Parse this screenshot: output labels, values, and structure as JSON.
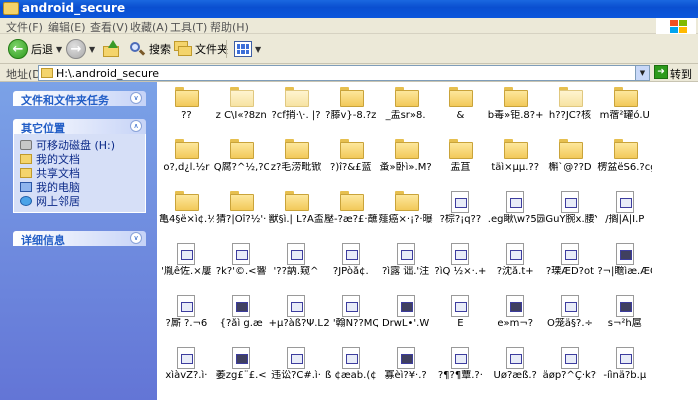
{
  "window": {
    "title": "android_secure"
  },
  "menu": [
    "文件(F)",
    "编辑(E)",
    "查看(V)",
    "收藏(A)",
    "工具(T)",
    "帮助(H)"
  ],
  "toolbar": {
    "back": "后退",
    "search": "搜索",
    "folders": "文件夹"
  },
  "address": {
    "label": "地址(D)",
    "value": "H:\\.android_secure",
    "go": "转到"
  },
  "panels": {
    "tasks": {
      "title": "文件和文件夹任务"
    },
    "other": {
      "title": "其它位置",
      "items": [
        "可移动磁盘 (H:)",
        "我的文档",
        "共享文档",
        "我的电脑",
        "网上邻居"
      ]
    },
    "details": {
      "title": "详细信息"
    }
  },
  "items": [
    {
      "type": "folder",
      "label": "??"
    },
    {
      "type": "folder",
      "label": "z C\\I«?8zn"
    },
    {
      "type": "folder",
      "label": "?cf捎·\\·. |?"
    },
    {
      "type": "folder",
      "label": "?藤v}-8.?z"
    },
    {
      "type": "folder",
      "label": "_盂sr»8."
    },
    {
      "type": "folder",
      "label": "&"
    },
    {
      "type": "folder",
      "label": "b毒»钜.8?+>"
    },
    {
      "type": "folder",
      "label": "h??JC?核"
    },
    {
      "type": "folder",
      "label": "m蓿²罐ó.U"
    },
    {
      "type": "folder",
      "label": "o?,d¿l.½r"
    },
    {
      "type": "folder",
      "label": "Q腐?^½,?ÓÎ"
    },
    {
      "type": "folder",
      "label": "z?毛涝毗锨"
    },
    {
      "type": "folder",
      "label": "?)î?&£蓝"
    },
    {
      "type": "folder",
      "label": "蚤»卧ì».M?"
    },
    {
      "type": "folder",
      "label": "盂苴"
    },
    {
      "type": "folder",
      "label": "täì×µµ.??"
    },
    {
      "type": "folder",
      "label": "槲`@??D"
    },
    {
      "type": "folder",
      "label": "楞盆ëS6.?cg"
    },
    {
      "type": "folder",
      "label": "亀4§ë×ì¢.½缺"
    },
    {
      "type": "folder",
      "label": "猜?|Öî?½'·"
    },
    {
      "type": "folder",
      "label": "獸§ì.|  L?A盃"
    },
    {
      "type": "folder",
      "label": "壓-?æ?£·蘸"
    },
    {
      "type": "folder",
      "label": "薤癌×·¡?·曝"
    },
    {
      "type": "file",
      "label": "?棕?¡q??"
    },
    {
      "type": "file",
      "label": ".eg瞅\\w?5园"
    },
    {
      "type": "file",
      "label": "ìGuY腕x.腰Y"
    },
    {
      "type": "file",
      "label": "/搁|Â|I.P"
    },
    {
      "type": "file",
      "label": "'胤ê佐.×屢"
    },
    {
      "type": "file",
      "label": "?k?'©.<響"
    },
    {
      "type": "file",
      "label": "'??訥.窥^"
    },
    {
      "type": "file",
      "label": "?JPòå¢."
    },
    {
      "type": "file",
      "label": "?ì露 诎.'注"
    },
    {
      "type": "file",
      "label": "?ìQ ½×·.+"
    },
    {
      "type": "file",
      "label": "?沈å.t+"
    },
    {
      "type": "file",
      "label": "?瑮ÆD?ot"
    },
    {
      "type": "file",
      "label": "?¬|瞻ìæ.ÆÓ"
    },
    {
      "type": "file",
      "label": "?廝  ?.¬6"
    },
    {
      "type": "file",
      "label": "{?åì  g.æ"
    },
    {
      "type": "file",
      "label": "+µ?àß?Ψ.LS"
    },
    {
      "type": "file",
      "label": "2 '翰N??MQc"
    },
    {
      "type": "file",
      "label": "DrwL•'.W"
    },
    {
      "type": "file",
      "label": "E"
    },
    {
      "type": "file",
      "label": "e»m¬?"
    },
    {
      "type": "file",
      "label": "O笼ä§?.÷"
    },
    {
      "type": "file",
      "label": "s¬­²h扈"
    },
    {
      "type": "file",
      "label": "xìàvZ?.ì·"
    },
    {
      "type": "file",
      "label": "萎zg£¨£.<"
    },
    {
      "type": "file",
      "label": "违讼?C#.ì·"
    },
    {
      "type": "file",
      "label": "ß ¢æab.(¢"
    },
    {
      "type": "file",
      "label": "寡èì?¥·.?"
    },
    {
      "type": "file",
      "label": "?¶?¶蕈.?·"
    },
    {
      "type": "file",
      "label": "Uø?æß.?"
    },
    {
      "type": "file",
      "label": "äøp?^Ç·k?¶"
    },
    {
      "type": "file",
      "label": "-íìnä?b.µ"
    }
  ]
}
